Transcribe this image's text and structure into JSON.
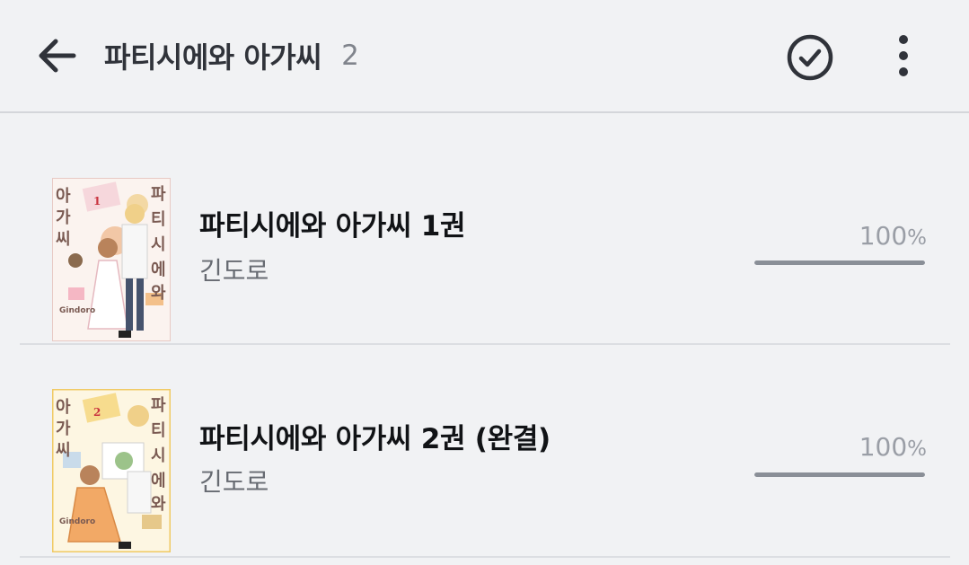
{
  "header": {
    "title": "파티시에와 아가씨",
    "count": "2"
  },
  "books": [
    {
      "title": "파티시에와 아가씨 1권",
      "author": "긴도로",
      "progress_value": "100",
      "progress_unit": "%",
      "progress": 1.0,
      "cover": {
        "vertical_text_left": [
          "아",
          "가",
          "씨"
        ],
        "vertical_text_right": [
          "파",
          "티",
          "시",
          "에",
          "와"
        ],
        "volume": "1",
        "byline": "Gindoro",
        "bg_color": "#fbf3ef",
        "accent_color": "#e98d96"
      }
    },
    {
      "title": "파티시에와 아가씨 2권 (완결)",
      "author": "긴도로",
      "progress_value": "100",
      "progress_unit": "%",
      "progress": 1.0,
      "cover": {
        "vertical_text_left": [
          "아",
          "가",
          "씨"
        ],
        "vertical_text_right": [
          "파",
          "티",
          "시",
          "에",
          "와"
        ],
        "volume": "2",
        "byline": "Gindoro",
        "bg_color": "#fdf6e2",
        "accent_color": "#f0b63c"
      }
    }
  ],
  "icons": {
    "back": "arrow-left-icon",
    "select": "check-circle-icon",
    "more": "more-vertical-icon"
  }
}
